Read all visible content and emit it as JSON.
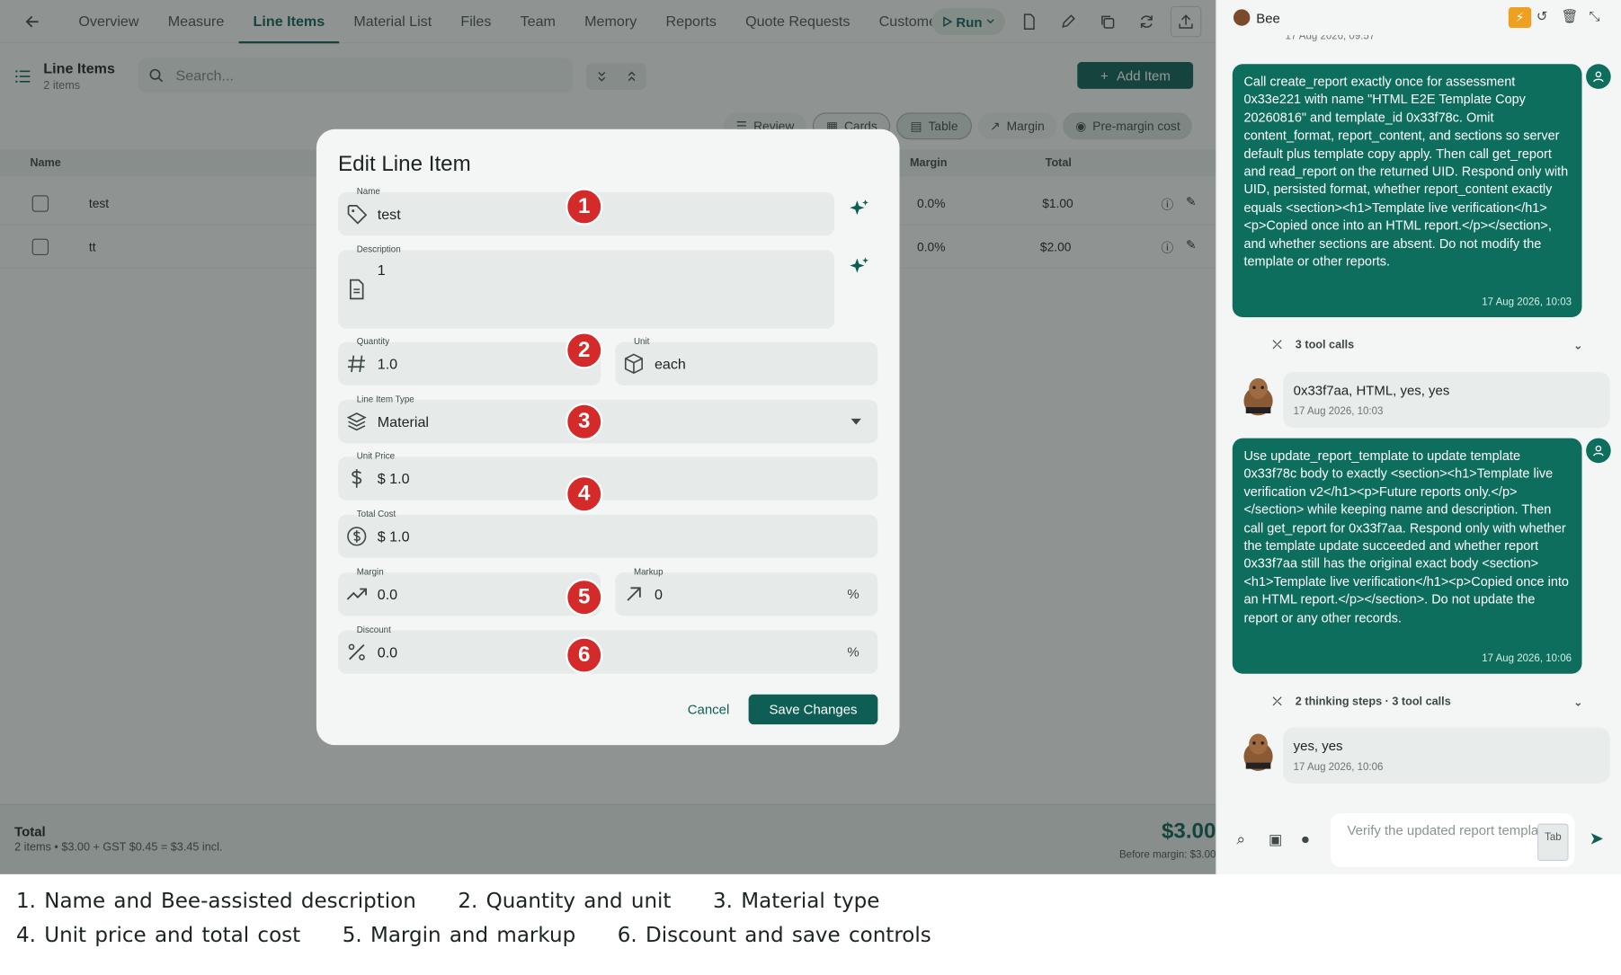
{
  "nav": {
    "tabs": [
      "Overview",
      "Measure",
      "Line Items",
      "Material List",
      "Files",
      "Team",
      "Memory",
      "Reports",
      "Quote Requests",
      "Customer"
    ],
    "active_tab": "Line Items",
    "run_label": "Run"
  },
  "page": {
    "title": "Line Items",
    "count": "2 items",
    "search_placeholder": "Search...",
    "add_item": "Add Item"
  },
  "views": {
    "review": "Review",
    "cards": "Cards",
    "table": "Table",
    "margin": "Margin",
    "pre_margin": "Pre-margin cost"
  },
  "table": {
    "headers": {
      "name": "Name",
      "margin": "Margin",
      "total": "Total"
    },
    "rows": [
      {
        "name": "test",
        "margin": "0.0%",
        "total": "$1.00"
      },
      {
        "name": "tt",
        "margin": "0.0%",
        "total": "$2.00"
      }
    ]
  },
  "totals": {
    "label": "Total",
    "summary": "2 items • $3.00 + GST $0.45 = $3.45 incl.",
    "amount": "$3.00",
    "before_margin": "Before margin: $3.00"
  },
  "modal": {
    "title": "Edit Line Item",
    "name": {
      "label": "Name",
      "value": "test"
    },
    "description": {
      "label": "Description",
      "value": "1"
    },
    "quantity": {
      "label": "Quantity",
      "value": "1.0"
    },
    "unit": {
      "label": "Unit",
      "value": "each"
    },
    "type": {
      "label": "Line Item Type",
      "value": "Material"
    },
    "unit_price": {
      "label": "Unit Price",
      "value": "$ 1.0"
    },
    "total_cost": {
      "label": "Total Cost",
      "value": "$ 1.0"
    },
    "margin": {
      "label": "Margin",
      "value": "0.0"
    },
    "markup": {
      "label": "Markup",
      "value": "0",
      "suffix": "%"
    },
    "discount": {
      "label": "Discount",
      "value": "0.0",
      "suffix": "%"
    },
    "cancel": "Cancel",
    "save": "Save Changes"
  },
  "markers": [
    "1",
    "2",
    "3",
    "4",
    "5",
    "6"
  ],
  "chat": {
    "title": "Bee",
    "first_time": "17 Aug 2026, 09:57",
    "messages": [
      {
        "role": "user",
        "text": "Call create_report exactly once for assessment 0x33e221 with name \"HTML E2E Template Copy 20260816\" and template_id 0x33f78c. Omit content_format, report_content, and sections so server default plus template copy apply. Then call get_report and read_report on the returned UID. Respond only with UID, persisted format, whether report_content exactly equals <section><h1>Template live verification</h1><p>Copied once into an HTML report.</p></section>, and whether sections are absent. Do not modify the template or other reports.",
        "time": "17 Aug 2026, 10:03"
      },
      {
        "role": "tool",
        "text": "3 tool calls"
      },
      {
        "role": "bee",
        "text": "0x33f7aa, HTML, yes, yes",
        "time": "17 Aug 2026, 10:03"
      },
      {
        "role": "user",
        "text": "Use update_report_template to update template 0x33f78c body to exactly <section><h1>Template live verification v2</h1><p>Future reports only.</p></section> while keeping name and description. Then call get_report for 0x33f7aa. Respond only with whether the template update succeeded and whether report 0x33f7aa still has the original exact body <section><h1>Template live verification</h1><p>Copied once into an HTML report.</p></section>. Do not update the report or any other records.",
        "time": "17 Aug 2026, 10:06"
      },
      {
        "role": "tool",
        "text": "2 thinking steps · 3 tool calls"
      },
      {
        "role": "bee",
        "text": "yes, yes",
        "time": "17 Aug 2026, 10:06"
      }
    ],
    "input_placeholder": "Verify the updated report template",
    "tab_hint": "Tab"
  },
  "legend": {
    "line1": [
      "1. Name and Bee-assisted description",
      "2. Quantity and unit",
      "3. Material type"
    ],
    "line2": [
      "4. Unit price and total cost",
      "5. Margin and markup",
      "6. Discount and save controls"
    ]
  },
  "colors": {
    "accent": "#0e5e55",
    "marker": "#d42a2a",
    "bubble": "#0e6e5e"
  }
}
